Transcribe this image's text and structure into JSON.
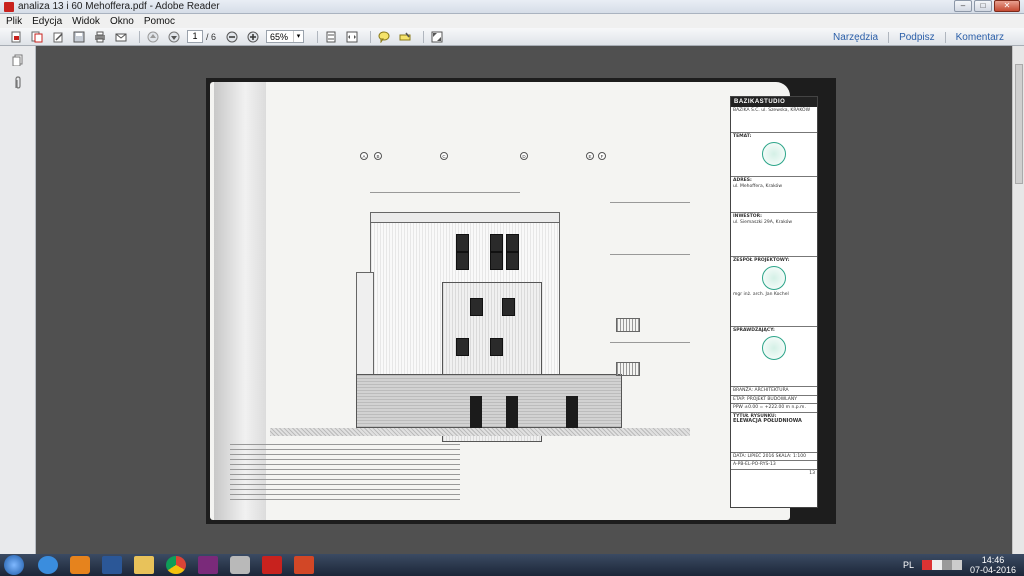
{
  "window": {
    "title": "analiza 13 i 60 Mehoffera.pdf - Adobe Reader",
    "min_label": "–",
    "max_label": "□",
    "close_label": "✕"
  },
  "menu": [
    "Plik",
    "Edycja",
    "Widok",
    "Okno",
    "Pomoc"
  ],
  "toolbar": {
    "current_page": "1",
    "page_total": "/ 6",
    "zoom": "65%",
    "zoom_arrow": "▾",
    "right_links": [
      "Narzędzia",
      "Podpisz",
      "Komentarz"
    ]
  },
  "document": {
    "title_block": {
      "logo": "BAZIKASTUDIO",
      "company": "BAZIKA S.C. ul. Szewska, KRAKÓW",
      "topic_label": "TEMAT:",
      "address_label": "ADRES:",
      "address_value": "ul. Mehoffera, Kraków",
      "investor_label": "INWESTOR:",
      "investor_value": "ul. Siemaszki 29A, Kraków",
      "team_label": "ZESPÓŁ PROJEKTOWY:",
      "designer_label": "mgr inż. arch. Jan Kochel",
      "checker_label": "SPRAWDZAJĄCY:",
      "branch_label": "BRANŻA: ARCHITEKTURA",
      "stage_label": "ETAP: PROJEKT BUDOWLANY",
      "ppw_label": "PPW ±0.00 = +222.00 m n.p.m.",
      "drawing_title_label": "TYTUŁ RYSUNKU:",
      "drawing_title": "ELEWACJA POŁUDNIOWA",
      "date_label": "DATA: LIPIEC 2016",
      "scale_label": "SKALA: 1:100",
      "sheet_no": "A-PB-EL-PO-RYS-13"
    },
    "grid_axes": [
      "A",
      "B",
      "C",
      "D",
      "E",
      "F"
    ],
    "page_number": "13"
  },
  "taskbar": {
    "lang": "PL",
    "time": "14:46",
    "date": "07-04-2016",
    "apps": [
      "start",
      "internet-explorer",
      "media-player",
      "word",
      "file-explorer",
      "chrome",
      "winrar",
      "binoculars",
      "adobe-reader",
      "powerpoint"
    ]
  },
  "colors": {
    "adobe_red": "#c8221e",
    "link_blue": "#2a5ea8",
    "stamp_green": "#2ca589"
  }
}
